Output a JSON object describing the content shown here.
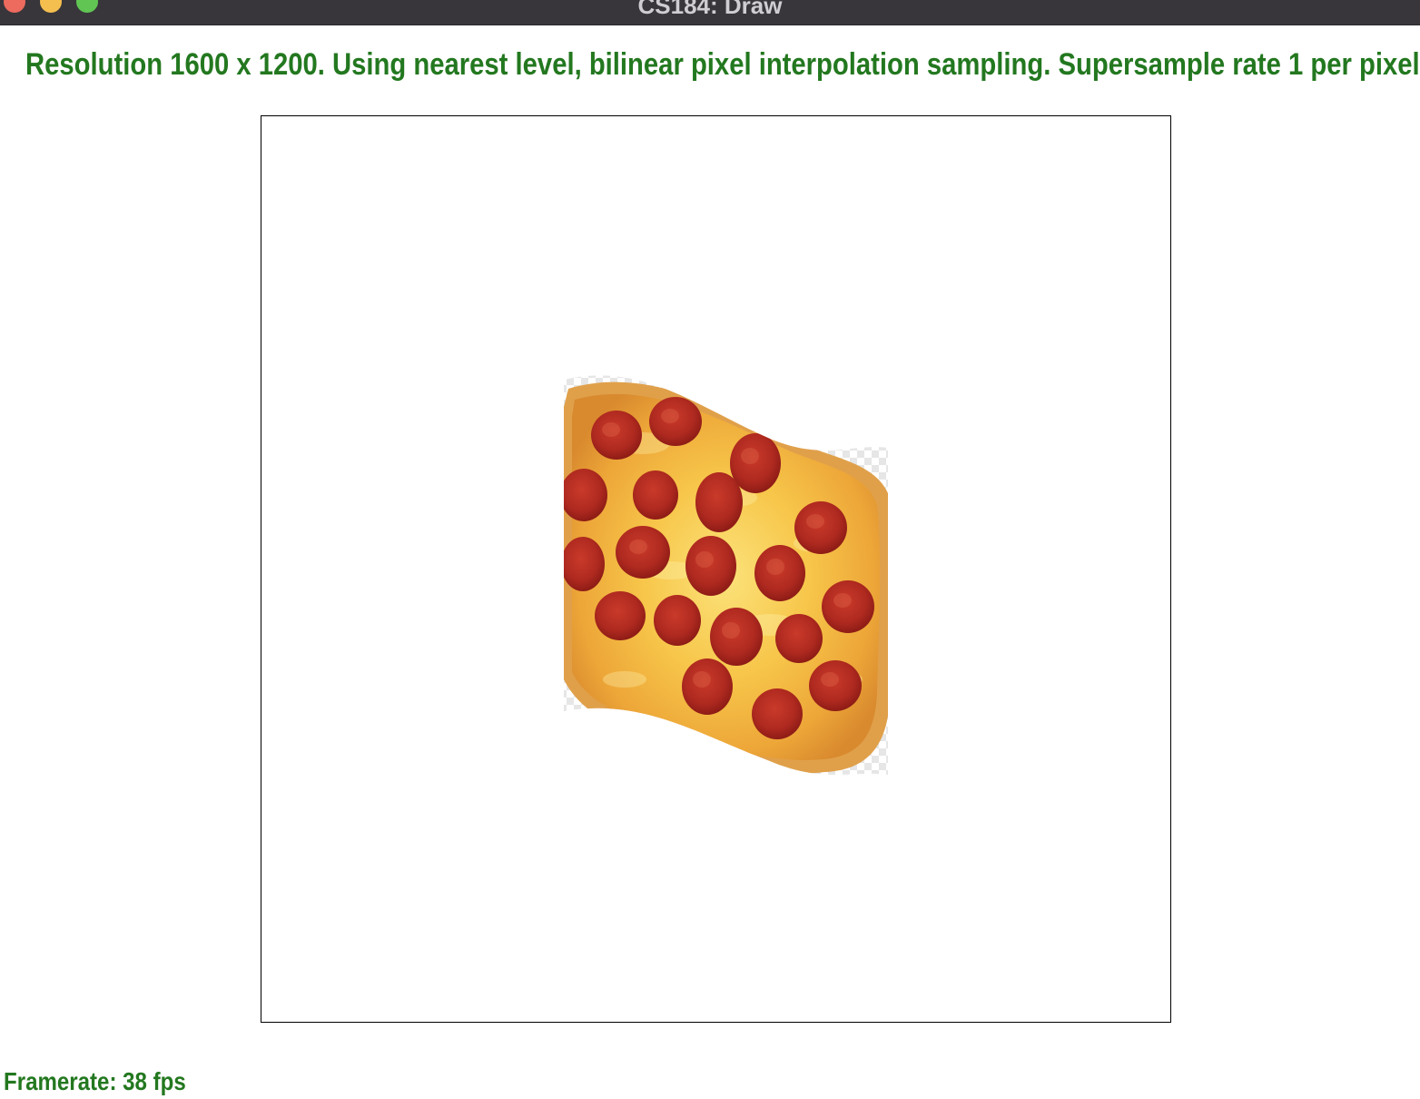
{
  "window": {
    "title": "CS184: Draw",
    "controls": [
      "close",
      "minimize",
      "zoom"
    ]
  },
  "status": {
    "text": "Resolution 1600 x 1200. Using nearest level, bilinear pixel interpolation sampling. Supersample rate 1 per pixel."
  },
  "canvas": {
    "content": "pepperoni-pizza-texture",
    "border_color": "#000000",
    "background": "#ffffff"
  },
  "footer": {
    "framerate_text": "Framerate: 38 fps"
  },
  "colors": {
    "status_text": "#23781f",
    "titlebar": "#38363b",
    "close": "#ec6a5e",
    "minimize": "#f4bf4f",
    "zoom": "#61c554"
  }
}
